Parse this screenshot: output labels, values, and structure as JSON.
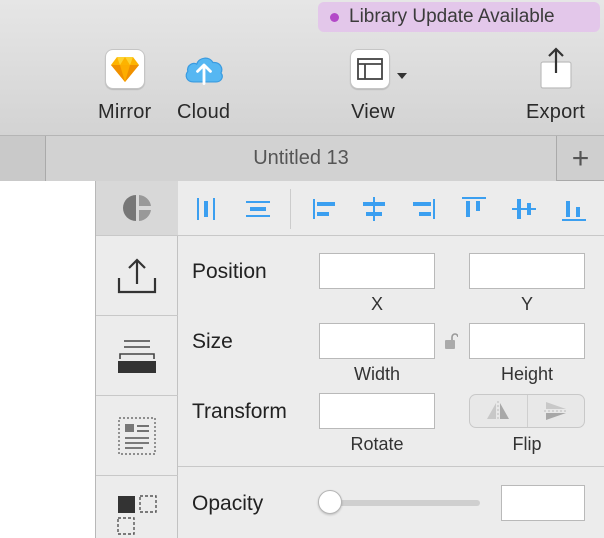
{
  "toolbar": {
    "library_update": "Library Update Available",
    "mirror_label": "Mirror",
    "cloud_label": "Cloud",
    "view_label": "View",
    "export_label": "Export"
  },
  "tabs": {
    "document_title": "Untitled 13",
    "add_tab": "+"
  },
  "inspector": {
    "position_label": "Position",
    "x_label": "X",
    "y_label": "Y",
    "size_label": "Size",
    "width_label": "Width",
    "height_label": "Height",
    "transform_label": "Transform",
    "rotate_label": "Rotate",
    "flip_label": "Flip",
    "opacity_label": "Opacity",
    "opacity_value": 0.0
  },
  "icons": {
    "mirror": "sketch-diamond-icon",
    "cloud": "cloud-upload-icon",
    "view": "view-layout-icon",
    "export": "export-share-icon",
    "lock": "unlock-icon"
  },
  "colors": {
    "badge_bg": "#e3c7ea",
    "badge_dot": "#b349c8",
    "align_icon": "#3b9ff0",
    "cloud": "#3ea8ee",
    "sketch_diamond": "#f7b500"
  }
}
